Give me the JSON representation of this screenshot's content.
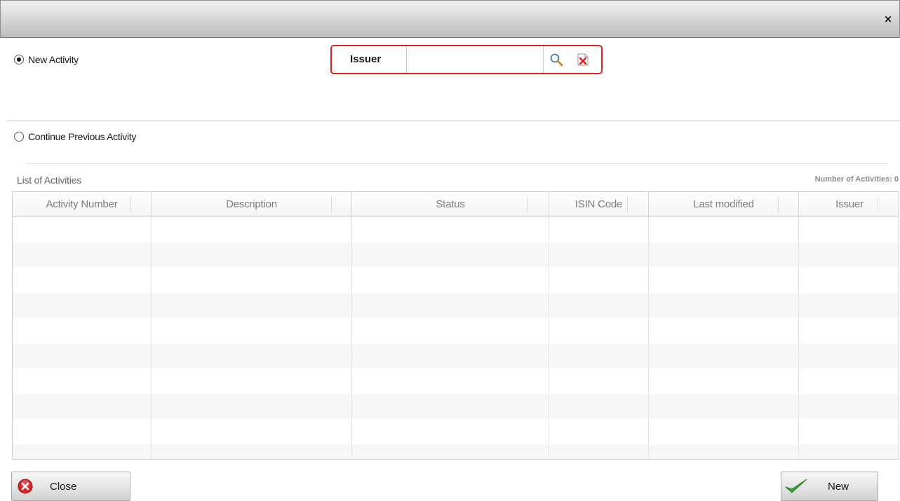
{
  "dialog": {
    "close_glyph": "×"
  },
  "new_activity": {
    "label": "New Activity",
    "checked": true
  },
  "issuer": {
    "label": "Issuer",
    "value": "",
    "search_icon": "search-icon",
    "clear_icon": "clear-icon"
  },
  "continue_activity": {
    "label": "Continue Previous Activity",
    "checked": false
  },
  "list": {
    "title": "List of Activities",
    "count_label": "Number of Activities: 0",
    "columns": [
      "Activity Number",
      "Description",
      "Status",
      "ISIN Code",
      "Last modified",
      "Issuer"
    ]
  },
  "buttons": {
    "close_label": "Close",
    "new_label": "New"
  },
  "colors": {
    "highlight": "#e0201e",
    "accent_green": "#3aa52d",
    "close_red": "#d2262a"
  }
}
